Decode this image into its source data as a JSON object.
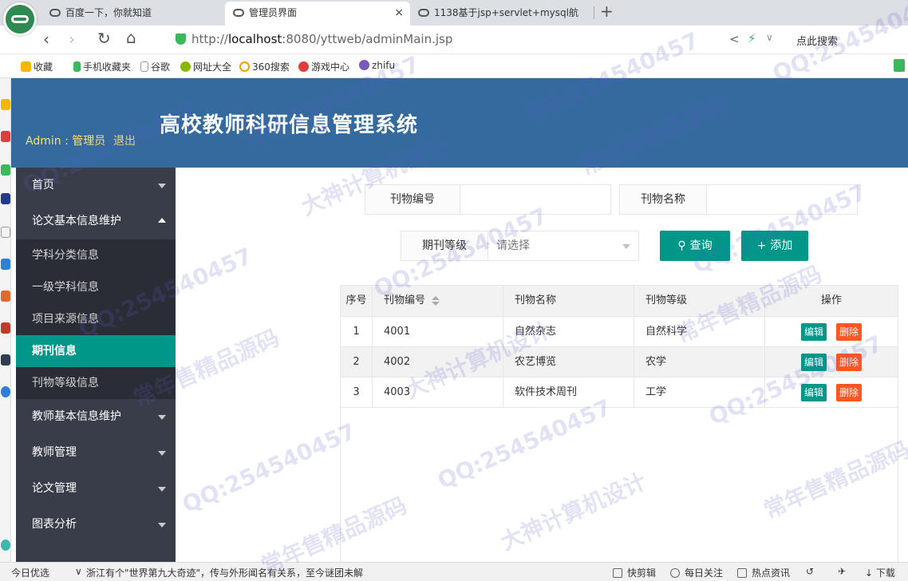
{
  "browser": {
    "tabs": [
      {
        "title": "百度一下，你就知道"
      },
      {
        "title": "管理员界面",
        "close": "×"
      },
      {
        "title": "1138基于jsp+servlet+mysql航"
      }
    ],
    "new_tab": "+",
    "url_prefix": "http://",
    "url_host": "localhost",
    "url_rest": ":8080/yttweb/adminMain.jsp",
    "search_hint": "点此搜索",
    "bookmarks": [
      "收藏",
      "手机收藏夹",
      "谷歌",
      "网址大全",
      "360搜索",
      "游戏中心",
      "zhifu"
    ]
  },
  "header": {
    "admin_info": "Admin : 管理员",
    "logout": "退出",
    "title": "高校教师科研信息管理系统"
  },
  "menu": {
    "items": [
      {
        "label": "首页"
      },
      {
        "label": "论文基本信息维护"
      },
      {
        "label": "教师基本信息维护"
      },
      {
        "label": "教师管理"
      },
      {
        "label": "论文管理"
      },
      {
        "label": "图表分析"
      }
    ],
    "sub_items": [
      {
        "label": "学科分类信息"
      },
      {
        "label": "一级学科信息"
      },
      {
        "label": "项目来源信息"
      },
      {
        "label": "期刊信息"
      },
      {
        "label": "刊物等级信息"
      }
    ]
  },
  "search": {
    "code_label": "刊物编号",
    "code_value": "",
    "name_label": "刊物名称",
    "name_value": "",
    "level_label": "期刊等级",
    "level_placeholder": "请选择",
    "query_button": "查询",
    "add_button": "添加"
  },
  "table": {
    "columns": [
      "序号",
      "刊物编号",
      "刊物名称",
      "刊物等级",
      "操作"
    ],
    "rows": [
      {
        "index": "1",
        "code": "4001",
        "name": "自然杂志",
        "level": "自然科学"
      },
      {
        "index": "2",
        "code": "4002",
        "name": "农艺博览",
        "level": "农学"
      },
      {
        "index": "3",
        "code": "4003",
        "name": "软件技术周刊",
        "level": "工学"
      }
    ],
    "edit_label": "编辑",
    "delete_label": "删除"
  },
  "statusbar": {
    "left": "今日优选",
    "news": "浙江有个\"世界第九大奇迹\"，传与外形闻名有关系，至今谜团未解",
    "clip": "快剪辑",
    "follow": "每日关注",
    "hot": "热点资讯",
    "download": "下载"
  },
  "watermarks": [
    "大神计算机设计",
    "QQ:254540457",
    "常年售精品源码"
  ]
}
